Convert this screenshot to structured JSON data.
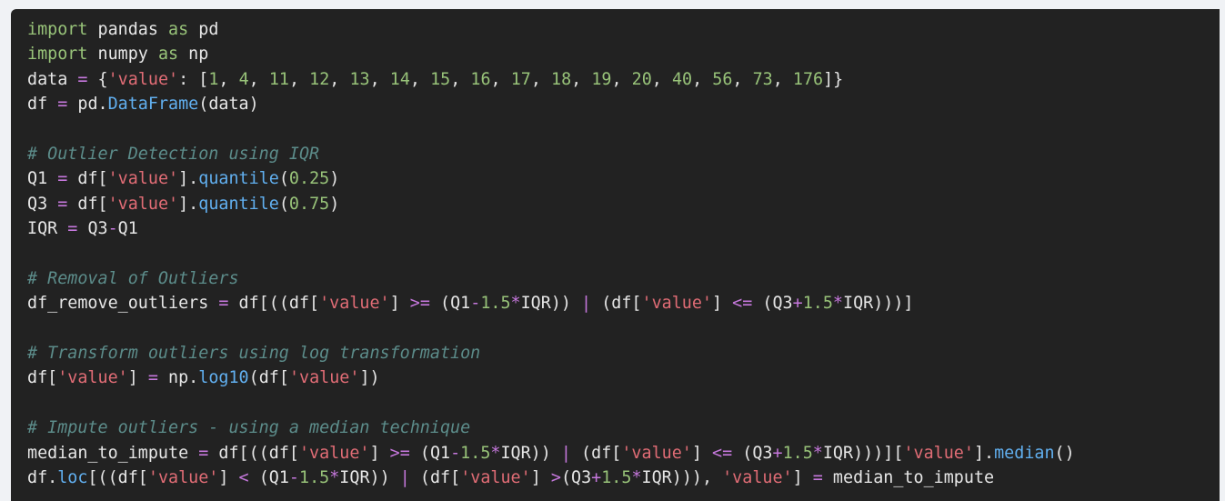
{
  "code": {
    "language": "python",
    "lines": [
      [
        {
          "t": "import",
          "k": "import"
        },
        {
          "t": " pandas ",
          "k": "plain"
        },
        {
          "t": "as",
          "k": "import"
        },
        {
          "t": " pd",
          "k": "plain"
        }
      ],
      [
        {
          "t": "import",
          "k": "import"
        },
        {
          "t": " numpy ",
          "k": "plain"
        },
        {
          "t": "as",
          "k": "import"
        },
        {
          "t": " np",
          "k": "plain"
        }
      ],
      [
        {
          "t": "data ",
          "k": "plain"
        },
        {
          "t": "=",
          "k": "op"
        },
        {
          "t": " {",
          "k": "plain"
        },
        {
          "t": "'value'",
          "k": "string"
        },
        {
          "t": ": [",
          "k": "plain"
        },
        {
          "t": "1",
          "k": "number"
        },
        {
          "t": ", ",
          "k": "plain"
        },
        {
          "t": "4",
          "k": "number"
        },
        {
          "t": ", ",
          "k": "plain"
        },
        {
          "t": "11",
          "k": "number"
        },
        {
          "t": ", ",
          "k": "plain"
        },
        {
          "t": "12",
          "k": "number"
        },
        {
          "t": ", ",
          "k": "plain"
        },
        {
          "t": "13",
          "k": "number"
        },
        {
          "t": ", ",
          "k": "plain"
        },
        {
          "t": "14",
          "k": "number"
        },
        {
          "t": ", ",
          "k": "plain"
        },
        {
          "t": "15",
          "k": "number"
        },
        {
          "t": ", ",
          "k": "plain"
        },
        {
          "t": "16",
          "k": "number"
        },
        {
          "t": ", ",
          "k": "plain"
        },
        {
          "t": "17",
          "k": "number"
        },
        {
          "t": ", ",
          "k": "plain"
        },
        {
          "t": "18",
          "k": "number"
        },
        {
          "t": ", ",
          "k": "plain"
        },
        {
          "t": "19",
          "k": "number"
        },
        {
          "t": ", ",
          "k": "plain"
        },
        {
          "t": "20",
          "k": "number"
        },
        {
          "t": ", ",
          "k": "plain"
        },
        {
          "t": "40",
          "k": "number"
        },
        {
          "t": ", ",
          "k": "plain"
        },
        {
          "t": "56",
          "k": "number"
        },
        {
          "t": ", ",
          "k": "plain"
        },
        {
          "t": "73",
          "k": "number"
        },
        {
          "t": ", ",
          "k": "plain"
        },
        {
          "t": "176",
          "k": "number"
        },
        {
          "t": "]}",
          "k": "plain"
        }
      ],
      [
        {
          "t": "df ",
          "k": "plain"
        },
        {
          "t": "=",
          "k": "op"
        },
        {
          "t": " pd.",
          "k": "plain"
        },
        {
          "t": "DataFrame",
          "k": "func"
        },
        {
          "t": "(data)",
          "k": "plain"
        }
      ],
      [],
      [
        {
          "t": "# Outlier Detection using IQR",
          "k": "comment"
        }
      ],
      [
        {
          "t": "Q1 ",
          "k": "plain"
        },
        {
          "t": "=",
          "k": "op"
        },
        {
          "t": " df[",
          "k": "plain"
        },
        {
          "t": "'value'",
          "k": "string"
        },
        {
          "t": "].",
          "k": "plain"
        },
        {
          "t": "quantile",
          "k": "func"
        },
        {
          "t": "(",
          "k": "plain"
        },
        {
          "t": "0.25",
          "k": "number"
        },
        {
          "t": ")",
          "k": "plain"
        }
      ],
      [
        {
          "t": "Q3 ",
          "k": "plain"
        },
        {
          "t": "=",
          "k": "op"
        },
        {
          "t": " df[",
          "k": "plain"
        },
        {
          "t": "'value'",
          "k": "string"
        },
        {
          "t": "].",
          "k": "plain"
        },
        {
          "t": "quantile",
          "k": "func"
        },
        {
          "t": "(",
          "k": "plain"
        },
        {
          "t": "0.75",
          "k": "number"
        },
        {
          "t": ")",
          "k": "plain"
        }
      ],
      [
        {
          "t": "IQR ",
          "k": "plain"
        },
        {
          "t": "=",
          "k": "op"
        },
        {
          "t": " Q3",
          "k": "plain"
        },
        {
          "t": "-",
          "k": "op"
        },
        {
          "t": "Q1",
          "k": "plain"
        }
      ],
      [],
      [
        {
          "t": "# Removal of Outliers",
          "k": "comment"
        }
      ],
      [
        {
          "t": "df_remove_outliers ",
          "k": "plain"
        },
        {
          "t": "=",
          "k": "op"
        },
        {
          "t": " df[((df[",
          "k": "plain"
        },
        {
          "t": "'value'",
          "k": "string"
        },
        {
          "t": "] ",
          "k": "plain"
        },
        {
          "t": ">=",
          "k": "op"
        },
        {
          "t": " (Q1",
          "k": "plain"
        },
        {
          "t": "-",
          "k": "op"
        },
        {
          "t": "1.5",
          "k": "number"
        },
        {
          "t": "*",
          "k": "op"
        },
        {
          "t": "IQR)) ",
          "k": "plain"
        },
        {
          "t": "|",
          "k": "op"
        },
        {
          "t": " (df[",
          "k": "plain"
        },
        {
          "t": "'value'",
          "k": "string"
        },
        {
          "t": "] ",
          "k": "plain"
        },
        {
          "t": "<=",
          "k": "op"
        },
        {
          "t": " (Q3",
          "k": "plain"
        },
        {
          "t": "+",
          "k": "op"
        },
        {
          "t": "1.5",
          "k": "number"
        },
        {
          "t": "*",
          "k": "op"
        },
        {
          "t": "IQR)))]",
          "k": "plain"
        }
      ],
      [],
      [
        {
          "t": "# Transform outliers using log transformation",
          "k": "comment"
        }
      ],
      [
        {
          "t": "df[",
          "k": "plain"
        },
        {
          "t": "'value'",
          "k": "string"
        },
        {
          "t": "] ",
          "k": "plain"
        },
        {
          "t": "=",
          "k": "op"
        },
        {
          "t": " np.",
          "k": "plain"
        },
        {
          "t": "log10",
          "k": "func"
        },
        {
          "t": "(df[",
          "k": "plain"
        },
        {
          "t": "'value'",
          "k": "string"
        },
        {
          "t": "])",
          "k": "plain"
        }
      ],
      [],
      [
        {
          "t": "# Impute outliers - using a median technique",
          "k": "comment"
        }
      ],
      [
        {
          "t": "median_to_impute ",
          "k": "plain"
        },
        {
          "t": "=",
          "k": "op"
        },
        {
          "t": " df[((df[",
          "k": "plain"
        },
        {
          "t": "'value'",
          "k": "string"
        },
        {
          "t": "] ",
          "k": "plain"
        },
        {
          "t": ">=",
          "k": "op"
        },
        {
          "t": " (Q1",
          "k": "plain"
        },
        {
          "t": "-",
          "k": "op"
        },
        {
          "t": "1.5",
          "k": "number"
        },
        {
          "t": "*",
          "k": "op"
        },
        {
          "t": "IQR)) ",
          "k": "plain"
        },
        {
          "t": "|",
          "k": "op"
        },
        {
          "t": " (df[",
          "k": "plain"
        },
        {
          "t": "'value'",
          "k": "string"
        },
        {
          "t": "] ",
          "k": "plain"
        },
        {
          "t": "<=",
          "k": "op"
        },
        {
          "t": " (Q3",
          "k": "plain"
        },
        {
          "t": "+",
          "k": "op"
        },
        {
          "t": "1.5",
          "k": "number"
        },
        {
          "t": "*",
          "k": "op"
        },
        {
          "t": "IQR)))][",
          "k": "plain"
        },
        {
          "t": "'value'",
          "k": "string"
        },
        {
          "t": "].",
          "k": "plain"
        },
        {
          "t": "median",
          "k": "func"
        },
        {
          "t": "()",
          "k": "plain"
        }
      ],
      [
        {
          "t": "df.",
          "k": "plain"
        },
        {
          "t": "loc",
          "k": "func"
        },
        {
          "t": "[((df[",
          "k": "plain"
        },
        {
          "t": "'value'",
          "k": "string"
        },
        {
          "t": "] ",
          "k": "plain"
        },
        {
          "t": "<",
          "k": "op"
        },
        {
          "t": " (Q1",
          "k": "plain"
        },
        {
          "t": "-",
          "k": "op"
        },
        {
          "t": "1.5",
          "k": "number"
        },
        {
          "t": "*",
          "k": "op"
        },
        {
          "t": "IQR)) ",
          "k": "plain"
        },
        {
          "t": "|",
          "k": "op"
        },
        {
          "t": " (df[",
          "k": "plain"
        },
        {
          "t": "'value'",
          "k": "string"
        },
        {
          "t": "] ",
          "k": "plain"
        },
        {
          "t": ">",
          "k": "op"
        },
        {
          "t": "(Q3",
          "k": "plain"
        },
        {
          "t": "+",
          "k": "op"
        },
        {
          "t": "1.5",
          "k": "number"
        },
        {
          "t": "*",
          "k": "op"
        },
        {
          "t": "IQR))), ",
          "k": "plain"
        },
        {
          "t": "'value'",
          "k": "string"
        },
        {
          "t": "] ",
          "k": "plain"
        },
        {
          "t": "=",
          "k": "op"
        },
        {
          "t": " median_to_impute",
          "k": "plain"
        }
      ]
    ]
  },
  "theme": {
    "background": "#222222",
    "page_background": "#f0f2f5",
    "plain": "#e6e6e6",
    "keyword": "#98c379",
    "operator": "#c678dd",
    "string": "#e06c75",
    "number": "#98c379",
    "function": "#61afef",
    "comment": "#5c8c8a"
  }
}
